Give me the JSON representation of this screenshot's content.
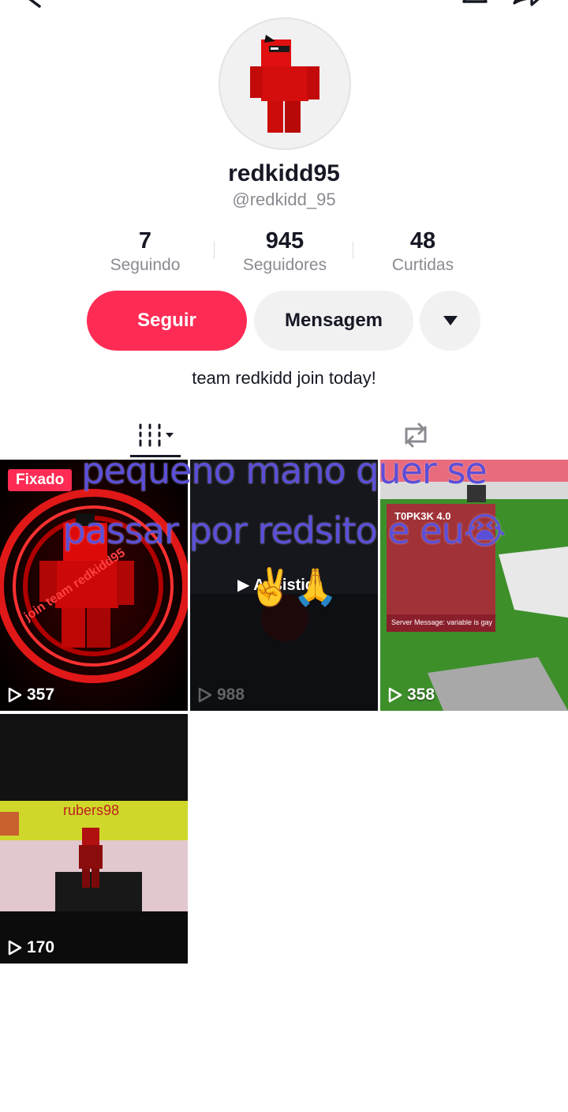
{
  "profile": {
    "username": "redkidd95",
    "handle": "@redkidd_95",
    "bio": "team redkidd join today!"
  },
  "stats": [
    {
      "value": "7",
      "label": "Seguindo"
    },
    {
      "value": "945",
      "label": "Seguidores"
    },
    {
      "value": "48",
      "label": "Curtidas"
    }
  ],
  "actions": {
    "follow_label": "Seguir",
    "message_label": "Mensagem"
  },
  "tabs": [
    "videos-grid-icon",
    "reposts-icon"
  ],
  "videos": [
    {
      "views": "357",
      "badge": "Fixado",
      "thumb_text": "join team redkidd95"
    },
    {
      "views": "988",
      "thumb_text": "Assistid"
    },
    {
      "views": "358",
      "thumb_title": "T0PK3K 4.0",
      "thumb_message": "Server Message: variable is gay"
    },
    {
      "views": "170",
      "thumb_text": "rubers98"
    }
  ],
  "overlay": {
    "line1": "pequeno mano quer se",
    "line2": "passar por redsito e eu😭",
    "emoji": "✌️🙏"
  },
  "colors": {
    "accent": "#fe2c55",
    "overlay_text": "#5b4fd8"
  }
}
